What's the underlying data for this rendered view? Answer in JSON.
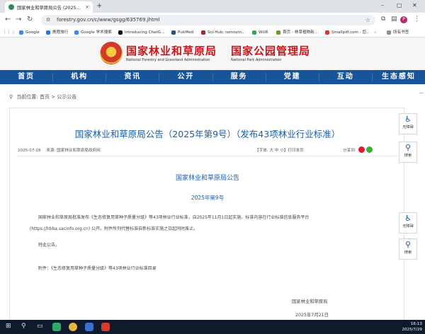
{
  "browser": {
    "tab_title": "国家林业和草原局公告 (2025...",
    "tab_close": "×",
    "new_tab": "+",
    "url": "forestry.gov.cn/c/www/gsgg/635769.jhtml",
    "window_controls": {
      "minimize": "–",
      "maximize": "▢",
      "close": "✕"
    },
    "profile_initial": "P",
    "bookmarks": [
      {
        "label": "Google",
        "color": "#4285f4"
      },
      {
        "label": "携程旅行",
        "color": "#2577e3"
      },
      {
        "label": "Google 学术搜索",
        "color": "#4285f4"
      },
      {
        "label": "Introducing ChatG...",
        "color": "#111111"
      },
      {
        "label": "PubMed",
        "color": "#20558a"
      },
      {
        "label": "Sci-Hub: removin...",
        "color": "#b22222"
      },
      {
        "label": "WUR",
        "color": "#34a853"
      },
      {
        "label": "首页 - 林草植物新...",
        "color": "#6a9a2b"
      },
      {
        "label": "Smallpdf.com - 您...",
        "color": "#e5322d"
      }
    ],
    "all_bookmarks": "所有书签"
  },
  "site": {
    "name_cn_1": "国家林业和草原局",
    "name_cn_2": "国家公园管理局",
    "name_en_1": "National Forestry and Grassland Administration",
    "name_en_2": "National Park Administration",
    "nav": [
      "首页",
      "机构",
      "资讯",
      "公开",
      "服务",
      "党建",
      "互动",
      "生态感知"
    ]
  },
  "breadcrumb": {
    "label": "当前位置:",
    "home": "首页",
    "sep": ">",
    "current": "公示公告"
  },
  "article": {
    "title": "国家林业和草原局公告（2025年第9号）（发布43项林业行业标准）",
    "date": "2025-07-28",
    "source": "来源: 国家林业和草原局政府网",
    "font_size": "【字体: 大 中 小】打印本页",
    "share_label": "分享到:",
    "heading": "国家林业和草原局公告",
    "number": "2025年第9号",
    "paragraph_1": "国家林业和草原局批准发布《生态修复用草种子质量分级》等43项林业行业标准，自2025年11月1日起实施。标准内容在行业标准信息服务平台",
    "paragraph_2": "(https://hbba.sacinfo.org.cn) 公开。附件所列代替标准自新标准实施之日起同时废止。",
    "paragraph_3": "特此公告。",
    "attachment": "附件：《生态修复用草种子质量分级》等43项林业行业标准目录",
    "sign_org": "国家林业和草原局",
    "sign_date": "2025年7月21日"
  },
  "side_tools": {
    "accessible": "无障碍",
    "search": "搜索"
  },
  "taskbar": {
    "time": "16:13",
    "date": "2025/7/29"
  }
}
